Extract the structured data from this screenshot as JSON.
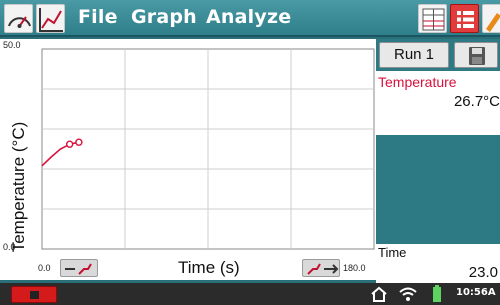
{
  "menu": {
    "file": "File",
    "graph": "Graph",
    "analyze": "Analyze",
    "icons": [
      "meter-icon",
      "graph-icon",
      "table-icon",
      "list-icon",
      "tool-icon"
    ]
  },
  "graph": {
    "ylabel": "Temperature (°C)",
    "xlabel": "Time (s)",
    "y_max_label": "50.0",
    "y_min_label": "0.0",
    "x_min_label": "0.0",
    "x_max_label": "180.0",
    "line_color": "#d8123c"
  },
  "chart_data": {
    "type": "line",
    "x": [
      0,
      5,
      10,
      15,
      20
    ],
    "y": [
      20.8,
      23.0,
      25.0,
      26.2,
      26.7
    ],
    "xlabel": "Time (s)",
    "ylabel": "Temperature (°C)",
    "xlim": [
      0,
      180
    ],
    "ylim": [
      0,
      50
    ],
    "grid": true,
    "markers_at_index": [
      3,
      4
    ]
  },
  "side_panel": {
    "run_label": "Run 1",
    "sensor_name": "Temperature",
    "sensor_value": "26.7°C",
    "time_name": "Time",
    "time_value": "23.0"
  },
  "status_bar": {
    "clock": "10:56A",
    "icons": [
      "home-icon",
      "wifi-icon",
      "battery-icon"
    ]
  }
}
